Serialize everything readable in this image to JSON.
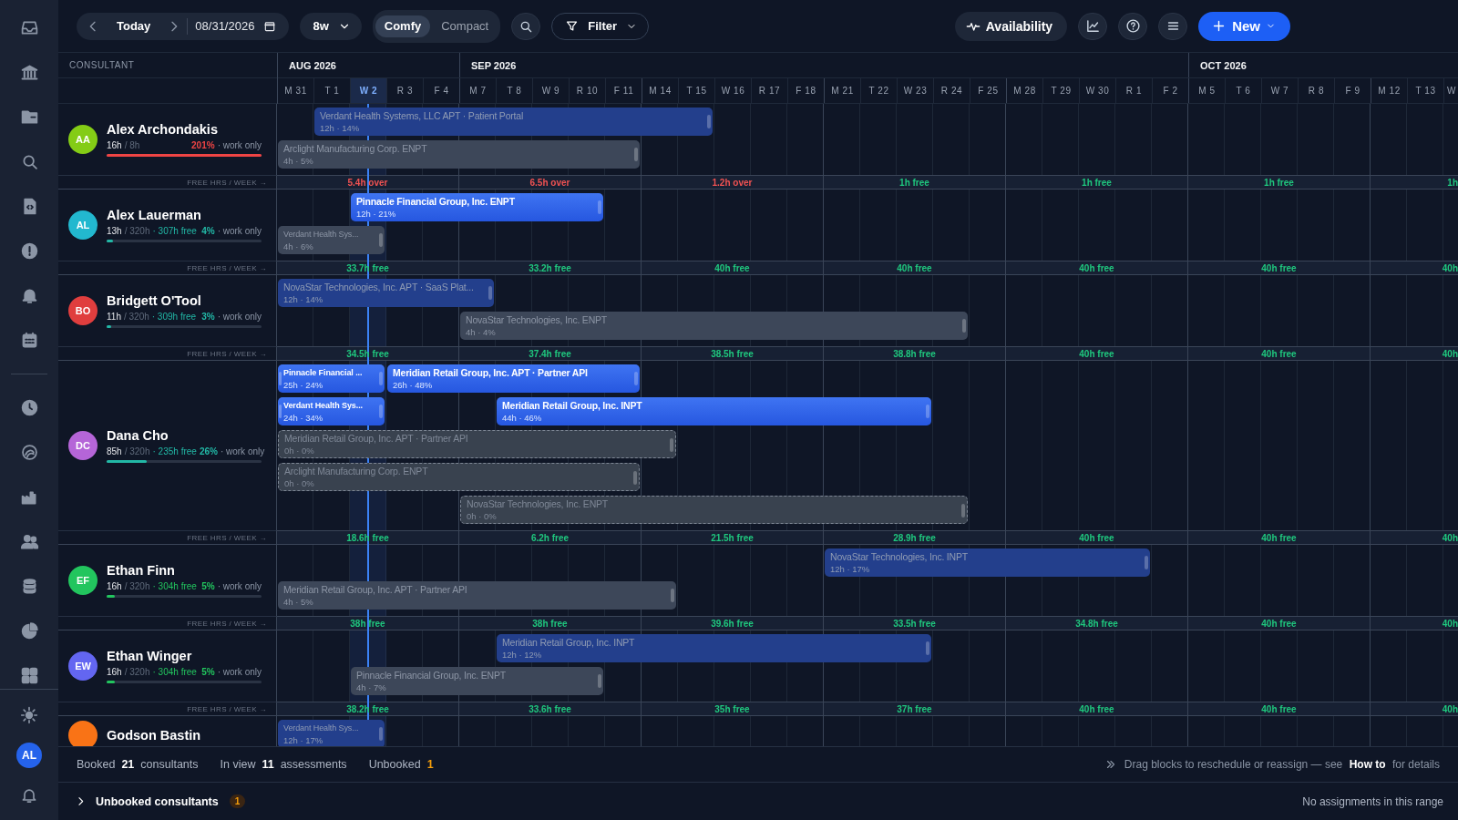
{
  "toolbar": {
    "today": "Today",
    "date": "08/31/2026",
    "range": "8w",
    "density": [
      {
        "label": "Comfy",
        "selected": true
      },
      {
        "label": "Compact",
        "selected": false
      }
    ],
    "filter": "Filter",
    "availability": "Availability",
    "new": "New"
  },
  "sidebar": {
    "user": "AL"
  },
  "header": {
    "consultant_heading": "CONSULTANT",
    "months": [
      {
        "label": "AUG 2026",
        "days": [
          {
            "label": "M 31",
            "selected": false
          },
          {
            "label": "T 1",
            "selected": false
          },
          {
            "label": "W 2",
            "selected": true
          },
          {
            "label": "R 3",
            "selected": false
          },
          {
            "label": "F 4",
            "selected": false
          }
        ]
      },
      {
        "label": "SEP 2026",
        "days": [
          {
            "label": "M 7",
            "selected": false
          },
          {
            "label": "T 8",
            "selected": false
          },
          {
            "label": "W 9",
            "selected": false
          },
          {
            "label": "R 10",
            "selected": false
          },
          {
            "label": "F 11",
            "selected": false
          },
          {
            "label": "M 14",
            "selected": false
          },
          {
            "label": "T 15",
            "selected": false
          },
          {
            "label": "W 16",
            "selected": false
          },
          {
            "label": "R 17",
            "selected": false
          },
          {
            "label": "F 18",
            "selected": false
          },
          {
            "label": "M 21",
            "selected": false
          },
          {
            "label": "T 22",
            "selected": false
          },
          {
            "label": "W 23",
            "selected": false
          },
          {
            "label": "R 24",
            "selected": false
          },
          {
            "label": "F 25",
            "selected": false
          },
          {
            "label": "M 28",
            "selected": false
          },
          {
            "label": "T 29",
            "selected": false
          },
          {
            "label": "W 30",
            "selected": false
          },
          {
            "label": "R 1",
            "selected": false
          },
          {
            "label": "F 2",
            "selected": false
          }
        ]
      },
      {
        "label": "OCT 2026",
        "days": [
          {
            "label": "M 5",
            "selected": false
          },
          {
            "label": "T 6",
            "selected": false
          },
          {
            "label": "W 7",
            "selected": false
          },
          {
            "label": "R 8",
            "selected": false
          },
          {
            "label": "F 9",
            "selected": false
          },
          {
            "label": "M 12",
            "selected": false
          },
          {
            "label": "T 13",
            "selected": false
          },
          {
            "label": "W",
            "selected": false
          }
        ]
      }
    ]
  },
  "consultants": [
    {
      "name": "Alex Archondakis",
      "avatar": {
        "initials": "AA",
        "color": "#84cc16"
      },
      "hours": "16h",
      "capacity": "/ 8h",
      "percent": "201%",
      "note": "· work only",
      "meter": {
        "level": 1,
        "color": "#ef4444"
      },
      "strip_label": "FREE HRS / WEEK →",
      "lanes": [
        {
          "bars": [
            {
              "title": "Verdant Health Systems, LLC APT · Patient Portal",
              "detail": "12h · 14%",
              "kind": "scheduled"
            }
          ]
        },
        {
          "bars": [
            {
              "title": "Arclight Manufacturing Corp. ENPT",
              "detail": "4h · 5%",
              "kind": "tentative"
            }
          ]
        }
      ],
      "weeks": [
        {
          "text": "5.4h over",
          "over": true
        },
        {
          "text": "6.5h over",
          "over": true
        },
        {
          "text": "1.2h over",
          "over": true
        },
        {
          "text": "1h free",
          "over": false
        },
        {
          "text": "1h free",
          "over": false
        },
        {
          "text": "1h free",
          "over": false
        },
        {
          "text": "1h",
          "over": false
        }
      ]
    },
    {
      "name": "Alex Lauerman",
      "avatar": {
        "initials": "AL",
        "color": "#22b8cf"
      },
      "hours": "13h",
      "capacity": "/ 320h",
      "free": "· 307h free",
      "percent": "4%",
      "note": "· work only",
      "meter": {
        "level": 0.04,
        "color": "#22b8a6"
      },
      "strip_label": "FREE HRS / WEEK →",
      "lanes": [
        {
          "bars": [
            {
              "title": "Pinnacle Financial Group, Inc. ENPT",
              "detail": "12h · 21%",
              "kind": "confirmed"
            }
          ]
        },
        {
          "bars": [
            {
              "title": "Verdant Health Sys...",
              "detail": "4h · 6%",
              "kind": "tentative"
            }
          ]
        }
      ],
      "weeks": [
        {
          "text": "33.7h free",
          "over": false
        },
        {
          "text": "33.2h free",
          "over": false
        },
        {
          "text": "40h free",
          "over": false
        },
        {
          "text": "40h free",
          "over": false
        },
        {
          "text": "40h free",
          "over": false
        },
        {
          "text": "40h free",
          "over": false
        },
        {
          "text": "40h",
          "over": false
        }
      ]
    },
    {
      "name": "Bridgett O'Tool",
      "avatar": {
        "initials": "BO",
        "color": "#e03e3e"
      },
      "hours": "11h",
      "capacity": "/ 320h",
      "free": "· 309h free",
      "percent": "3%",
      "note": "· work only",
      "meter": {
        "level": 0.03,
        "color": "#22b8a6"
      },
      "strip_label": "FREE HRS / WEEK →",
      "lanes": [
        {
          "bars": [
            {
              "title": "NovaStar Technologies, Inc. APT · SaaS Plat...",
              "detail": "12h · 14%",
              "kind": "scheduled"
            }
          ]
        },
        {
          "bars": [
            {
              "title": "NovaStar Technologies, Inc. ENPT",
              "detail": "4h · 4%",
              "kind": "tentative"
            }
          ]
        }
      ],
      "weeks": [
        {
          "text": "34.5h free",
          "over": false
        },
        {
          "text": "37.4h free",
          "over": false
        },
        {
          "text": "38.5h free",
          "over": false
        },
        {
          "text": "38.8h free",
          "over": false
        },
        {
          "text": "40h free",
          "over": false
        },
        {
          "text": "40h free",
          "over": false
        },
        {
          "text": "40h",
          "over": false
        }
      ]
    },
    {
      "name": "Dana Cho",
      "avatar": {
        "initials": "DC",
        "color": "#b565d8"
      },
      "hours": "85h",
      "capacity": "/ 320h",
      "free": "· 235h free",
      "percent": "26%",
      "note": "· work only",
      "meter": {
        "level": 0.26,
        "color": "#22b8a6"
      },
      "strip_label": "FREE HRS / WEEK →",
      "lanes": [
        {
          "bars": [
            {
              "title": "Pinnacle Financial ...",
              "detail": "25h · 24%",
              "kind": "confirmed"
            },
            {
              "title": "Meridian Retail Group, Inc. APT · Partner API",
              "detail": "26h · 48%",
              "kind": "confirmed"
            }
          ]
        },
        {
          "bars": [
            {
              "title": "Verdant Health Sys...",
              "detail": "24h · 34%",
              "kind": "confirmed"
            },
            {
              "title": "Meridian Retail Group, Inc. INPT",
              "detail": "44h · 46%",
              "kind": "confirmed"
            }
          ]
        },
        {
          "bars": [
            {
              "title": "Meridian Retail Group, Inc. APT · Partner API",
              "detail": "0h · 0%",
              "kind": "placeholder"
            }
          ]
        },
        {
          "bars": [
            {
              "title": "Arclight Manufacturing Corp. ENPT",
              "detail": "0h · 0%",
              "kind": "placeholder"
            }
          ]
        },
        {
          "bars": [
            {
              "title": "NovaStar Technologies, Inc. ENPT",
              "detail": "0h · 0%",
              "kind": "placeholder"
            }
          ]
        }
      ],
      "weeks": [
        {
          "text": "18.6h free",
          "over": false
        },
        {
          "text": "6.2h free",
          "over": false
        },
        {
          "text": "21.5h free",
          "over": false
        },
        {
          "text": "28.9h free",
          "over": false
        },
        {
          "text": "40h free",
          "over": false
        },
        {
          "text": "40h free",
          "over": false
        },
        {
          "text": "40h",
          "over": false
        }
      ]
    },
    {
      "name": "Ethan Finn",
      "avatar": {
        "initials": "EF",
        "color": "#22c55e"
      },
      "hours": "16h",
      "capacity": "/ 320h",
      "free": "· 304h free",
      "percent": "5%",
      "note": "· work only",
      "meter": {
        "level": 0.05,
        "color": "#22c55e"
      },
      "strip_label": "FREE HRS / WEEK →",
      "lanes": [
        {
          "bars": [
            {
              "title": "NovaStar Technologies, Inc. INPT",
              "detail": "12h · 17%",
              "kind": "scheduled"
            }
          ]
        },
        {
          "bars": [
            {
              "title": "Meridian Retail Group, Inc. APT · Partner API",
              "detail": "4h · 5%",
              "kind": "tentative"
            }
          ]
        }
      ],
      "weeks": [
        {
          "text": "38h free",
          "over": false
        },
        {
          "text": "38h free",
          "over": false
        },
        {
          "text": "39.6h free",
          "over": false
        },
        {
          "text": "33.5h free",
          "over": false
        },
        {
          "text": "34.8h free",
          "over": false
        },
        {
          "text": "40h free",
          "over": false
        },
        {
          "text": "40h",
          "over": false
        }
      ]
    },
    {
      "name": "Ethan Winger",
      "avatar": {
        "initials": "EW",
        "color": "#6366f1"
      },
      "hours": "16h",
      "capacity": "/ 320h",
      "free": "· 304h free",
      "percent": "5%",
      "note": "· work only",
      "meter": {
        "level": 0.05,
        "color": "#22c55e"
      },
      "strip_label": "FREE HRS / WEEK →",
      "lanes": [
        {
          "bars": [
            {
              "title": "Meridian Retail Group, Inc. INPT",
              "detail": "12h · 12%",
              "kind": "scheduled"
            }
          ]
        },
        {
          "bars": [
            {
              "title": "Pinnacle Financial Group, Inc. ENPT",
              "detail": "4h · 7%",
              "kind": "tentative"
            }
          ]
        }
      ],
      "weeks": [
        {
          "text": "38.2h free",
          "over": false
        },
        {
          "text": "33.6h free",
          "over": false
        },
        {
          "text": "35h free",
          "over": false
        },
        {
          "text": "37h free",
          "over": false
        },
        {
          "text": "40h free",
          "over": false
        },
        {
          "text": "40h free",
          "over": false
        },
        {
          "text": "40h",
          "over": false
        }
      ]
    },
    {
      "name": "Godson Bastin",
      "avatar": {
        "color": "#f97316"
      },
      "lanes": [
        {
          "bars": [
            {
              "title": "Verdant Health Sys...",
              "detail": "12h · 17%",
              "kind": "scheduled"
            }
          ]
        }
      ]
    }
  ],
  "footer": {
    "stats": [
      {
        "label": "Booked",
        "value": "21",
        "unit": "consultants",
        "warn": false
      },
      {
        "label": "In view",
        "value": "11",
        "unit": "assessments",
        "warn": false
      },
      {
        "label": "Unbooked",
        "value": "1",
        "warn": true
      }
    ],
    "hint": "Drag blocks to reschedule or reassign — see **How to** for details",
    "unbooked": {
      "label": "Unbooked consultants",
      "count": "1",
      "expanded": false
    },
    "empty": "No assignments in this range"
  }
}
